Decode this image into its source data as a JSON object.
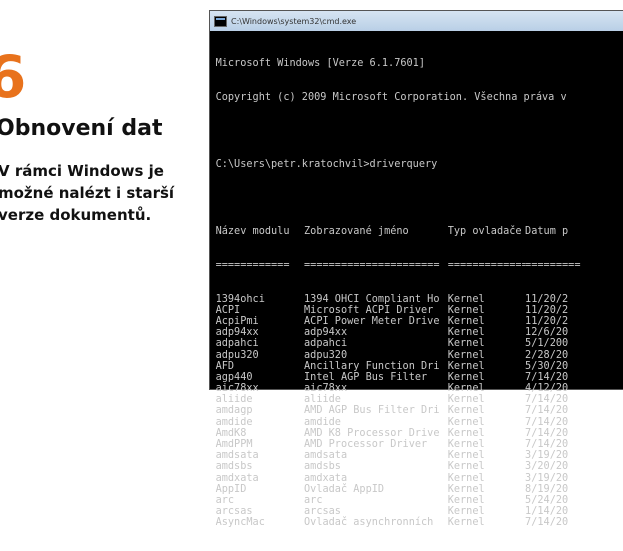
{
  "article": {
    "number": "6",
    "heading": "Obnovení dat",
    "desc_lines": [
      "V rámci Windows je",
      "možné nalézt i starší",
      "verze dokumentů."
    ]
  },
  "console": {
    "title": "C:\\Windows\\system32\\cmd.exe",
    "banner_1": "Microsoft Windows [Verze 6.1.7601]",
    "banner_2": "Copyright (c) 2009 Microsoft Corporation. Všechna práva v",
    "prompt": "C:\\Users\\petr.kratochvil>driverquery",
    "headers": [
      "Název modulu",
      "Zobrazované jméno",
      "Typ ovladače",
      "Datum p"
    ],
    "underline": [
      "============",
      "======================",
      "=============",
      "========="
    ],
    "rows": [
      [
        "1394ohci",
        "1394 OHCI Compliant Ho",
        "Kernel",
        "11/20/2"
      ],
      [
        "ACPI",
        "Microsoft ACPI Driver",
        "Kernel",
        "11/20/2"
      ],
      [
        "AcpiPmi",
        "ACPI Power Meter Drive",
        "Kernel",
        "11/20/2"
      ],
      [
        "adp94xx",
        "adp94xx",
        "Kernel",
        "12/6/20"
      ],
      [
        "adpahci",
        "adpahci",
        "Kernel",
        "5/1/200"
      ],
      [
        "adpu320",
        "adpu320",
        "Kernel",
        "2/28/20"
      ],
      [
        "AFD",
        "Ancillary Function Dri",
        "Kernel",
        "5/30/20"
      ],
      [
        "agp440",
        "Intel AGP Bus Filter",
        "Kernel",
        "7/14/20"
      ],
      [
        "aic78xx",
        "aic78xx",
        "Kernel",
        "4/12/20"
      ],
      [
        "aliide",
        "aliide",
        "Kernel",
        "7/14/20"
      ],
      [
        "amdagp",
        "AMD AGP Bus Filter Dri",
        "Kernel",
        "7/14/20"
      ],
      [
        "amdide",
        "amdide",
        "Kernel",
        "7/14/20"
      ],
      [
        "AmdK8",
        "AMD K8 Processor Drive",
        "Kernel",
        "7/14/20"
      ],
      [
        "AmdPPM",
        "AMD Processor Driver",
        "Kernel",
        "7/14/20"
      ],
      [
        "amdsata",
        "amdsata",
        "Kernel",
        "3/19/20"
      ],
      [
        "amdsbs",
        "amdsbs",
        "Kernel",
        "3/20/20"
      ],
      [
        "amdxata",
        "amdxata",
        "Kernel",
        "3/19/20"
      ],
      [
        "AppID",
        "Ovladač AppID",
        "Kernel",
        "8/19/20"
      ],
      [
        "arc",
        "arc",
        "Kernel",
        "5/24/20"
      ],
      [
        "arcsas",
        "arcsas",
        "Kernel",
        "1/14/20"
      ],
      [
        "AsyncMac",
        "Ovladač asynchronních",
        "Kernel",
        "7/14/20"
      ]
    ]
  }
}
